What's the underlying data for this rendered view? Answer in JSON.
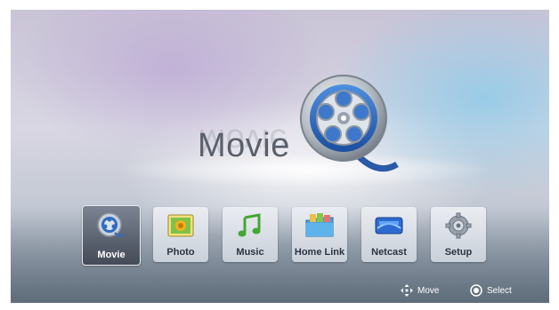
{
  "header": {
    "title": "Movie"
  },
  "menu": [
    {
      "label": "Movie",
      "icon": "film-reel-icon",
      "selected": true
    },
    {
      "label": "Photo",
      "icon": "photo-icon"
    },
    {
      "label": "Music",
      "icon": "music-note-icon"
    },
    {
      "label": "Home Link",
      "icon": "home-link-folder-icon"
    },
    {
      "label": "Netcast",
      "icon": "netcast-icon"
    },
    {
      "label": "Setup",
      "icon": "gear-icon"
    }
  ],
  "footer": {
    "move_label": "Move",
    "select_label": "Select"
  },
  "colors": {
    "accent": "#5a5f6b",
    "highlight": "#444a56"
  }
}
